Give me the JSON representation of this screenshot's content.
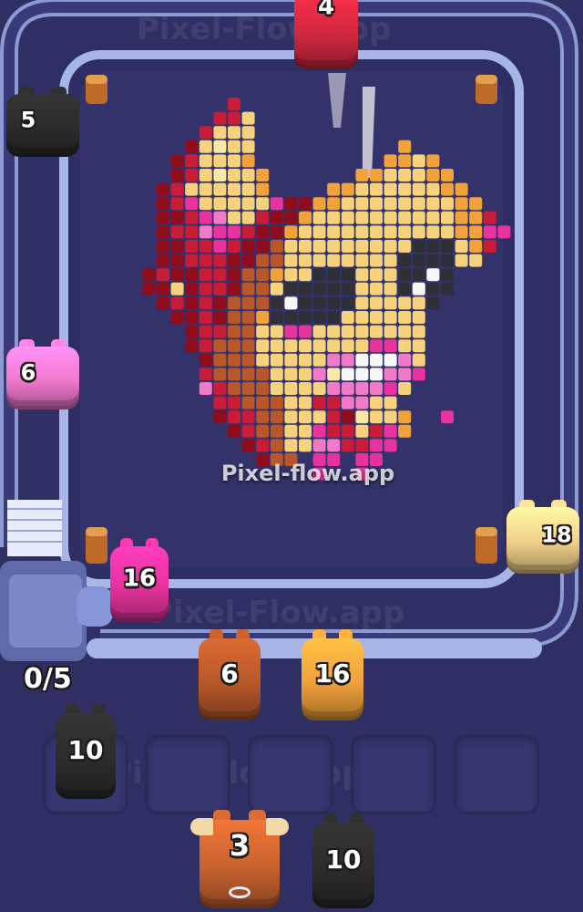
{
  "watermark": "Pixel-flow.app",
  "conveyor_watermark": "Pixel-Flow.app",
  "queue_counter": "0/5",
  "units": {
    "top_red": {
      "count": "4",
      "color": "#d3283f"
    },
    "left_black": {
      "count": "5",
      "color": "#2c2c2c"
    },
    "left_pink": {
      "count": "6",
      "color": "#f37ad0"
    },
    "right_cream": {
      "count": "18",
      "color": "#f2d08a"
    },
    "conveyor_magenta": {
      "count": "16",
      "color": "#e8339e"
    },
    "lane1_brown": {
      "count": "6",
      "color": "#b8582a"
    },
    "lane2_orange": {
      "count": "16",
      "color": "#f2a23a"
    },
    "slot1_black": {
      "count": "10",
      "color": "#2c2c2c"
    },
    "bottom_bull": {
      "count": "3",
      "color": "#c9622f"
    },
    "bottom_black": {
      "count": "10",
      "color": "#2c2c2c"
    }
  },
  "slots_count": 5,
  "palette": {
    "board": "#34336a",
    "conveyor": "#a8b5e8",
    "dark_red": "#8f0c1c",
    "red": "#c81c38",
    "magenta": "#e8339e",
    "pink": "#f07ac8",
    "brown": "#b8582a",
    "orange": "#f2a23a",
    "light": "#f7d27c",
    "cream": "#fbeaa7",
    "dark": "#2f2f3a",
    "white": "#f8f8f8"
  }
}
